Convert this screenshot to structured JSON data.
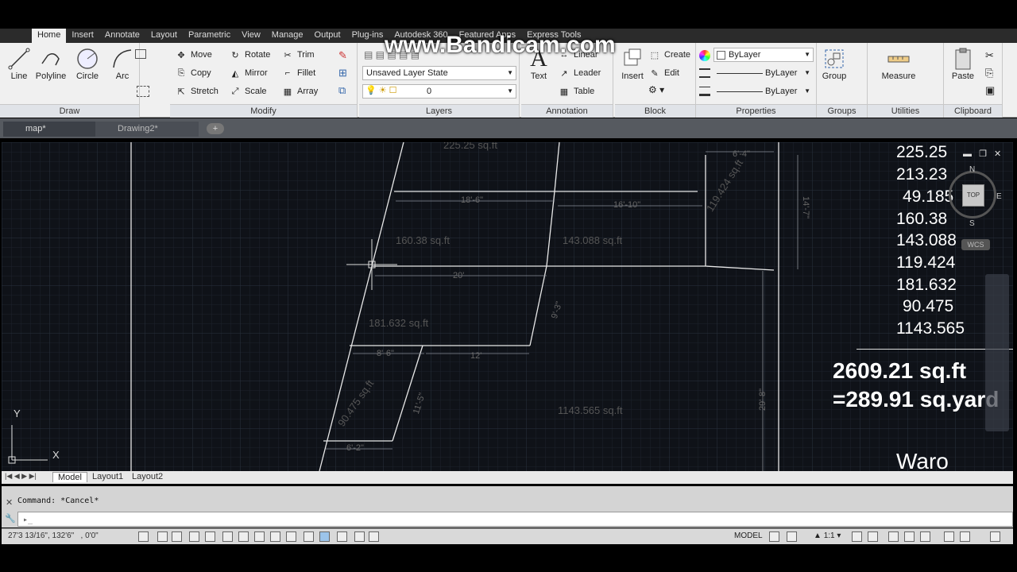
{
  "watermark": "www.Bandicam.com",
  "ribbon_tabs": [
    "Home",
    "Insert",
    "Annotate",
    "Layout",
    "Parametric",
    "View",
    "Manage",
    "Output",
    "Plug-ins",
    "Autodesk 360",
    "Featured Apps",
    "Express Tools"
  ],
  "draw": {
    "title": "Draw",
    "tools": [
      "Line",
      "Polyline",
      "Circle",
      "Arc"
    ]
  },
  "modify": {
    "title": "Modify",
    "tools": [
      "Move",
      "Rotate",
      "Trim",
      "Copy",
      "Mirror",
      "Fillet",
      "Stretch",
      "Scale",
      "Array"
    ]
  },
  "layers": {
    "title": "Layers",
    "layer_state": "Unsaved Layer State",
    "current_layer": "0"
  },
  "annotation": {
    "title": "Annotation",
    "text": "Text",
    "linear": "Linear",
    "leader": "Leader",
    "table": "Table"
  },
  "block": {
    "title": "Block",
    "insert": "Insert",
    "create": "Create",
    "edit": "Edit"
  },
  "properties": {
    "title": "Properties",
    "color": "ByLayer",
    "linetype": "ByLayer",
    "lineweight": "ByLayer"
  },
  "groups": {
    "title": "Groups",
    "group": "Group"
  },
  "utilities": {
    "title": "Utilities",
    "measure": "Measure"
  },
  "clipboard": {
    "title": "Clipboard",
    "paste": "Paste"
  },
  "doc_tabs": [
    "map*",
    "Drawing2*"
  ],
  "drawing": {
    "area_labels": [
      "225.25 sq.ft",
      "160.38 sq.ft",
      "143.088 sq.ft",
      "119.424 sq.ft",
      "181.632 sq.ft",
      "90.475 sq.ft",
      "1143.565 sq.ft"
    ],
    "dim_labels": [
      "18'-6\"",
      "16'-10\"",
      "20'",
      "8'-6\"",
      "12'",
      "6'-2\"",
      "6'-4\"",
      "14'-7\"",
      "29'-8\"",
      "11'-5\"",
      "9'-3\""
    ],
    "values": [
      "225.25",
      "213.23",
      "49.185",
      "160.38",
      "143.088",
      "119.424",
      "181.632",
      "90.475",
      "1143.565"
    ],
    "total_sqft": "2609.21 sq.ft",
    "total_sqyard": "=289.91 sq.yard",
    "bottom_text": "Waro"
  },
  "viewcube": {
    "top": "TOP",
    "n": "N",
    "e": "E",
    "s": "S",
    "wcs": "WCS"
  },
  "ucs": {
    "y": "Y",
    "x": "X"
  },
  "layout_tabs": [
    "Model",
    "Layout1",
    "Layout2"
  ],
  "command_history": "Command: *Cancel*",
  "status": {
    "coords": "27'3 13/16\", 132'6\"   , 0'0\"",
    "model": "MODEL",
    "scale": "1:1"
  }
}
